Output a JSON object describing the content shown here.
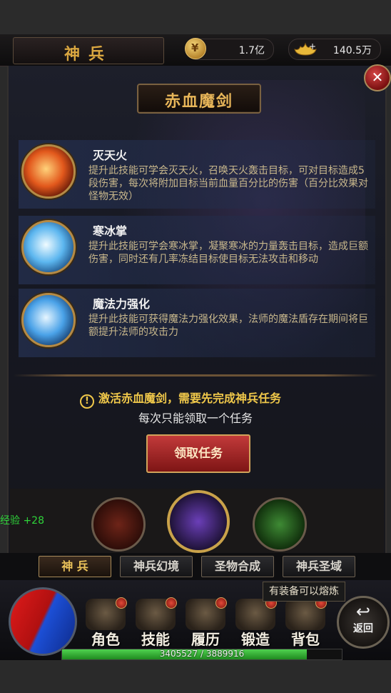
{
  "header": {
    "title": "神兵",
    "gold": "1.7亿",
    "ingot": "140.5万"
  },
  "panel": {
    "weapon_name": "赤血魔剑",
    "skills": [
      {
        "name": "灭天火",
        "desc": "提升此技能可学会灭天火，召唤天火轰击目标，可对目标造成5段伤害，每次将附加目标当前血量百分比的伤害（百分比效果对怪物无效）",
        "icon": "fire-skill-icon"
      },
      {
        "name": "寒冰掌",
        "desc": "提升此技能可学会寒冰掌，凝聚寒冰的力量轰击目标，造成巨额伤害，同时还有几率冻结目标使目标无法攻击和移动",
        "icon": "ice-skill-icon"
      },
      {
        "name": "魔法力强化",
        "desc": "提升此技能可获得魔法力强化效果，法师的魔法盾存在期间将巨额提升法师的攻击力",
        "icon": "magic-skill-icon"
      }
    ],
    "warning": "激活赤血魔剑，需要先完成神兵任务",
    "hint": "每次只能领取一个任务",
    "claim_label": "领取任务"
  },
  "exp_gain": "经验 +28",
  "tabs": [
    "神 兵",
    "神兵幻境",
    "圣物合成",
    "神兵圣域"
  ],
  "menu": [
    {
      "label": "角色"
    },
    {
      "label": "技能"
    },
    {
      "label": "履历"
    },
    {
      "label": "锻造"
    },
    {
      "label": "背包"
    }
  ],
  "back_label": "返回",
  "tooltip": "有装备可以熔炼",
  "exp": {
    "text": "3405527 / 3889916",
    "fraction": 0.8755
  },
  "colors": {
    "accent_gold": "#d9a640",
    "warning": "#f0c84a",
    "exp_green": "#2fd43a",
    "button_red": "#c23a3a"
  }
}
